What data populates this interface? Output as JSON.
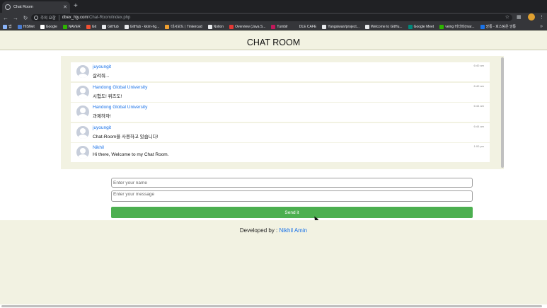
{
  "browser": {
    "tab_title": "Chat Room",
    "not_secure_label": "주의 요함",
    "url_host": "dbex_hjy.com",
    "url_path": "/Chat-Room/index.php",
    "bookmarks": [
      {
        "label": "앱",
        "color": "#8ab4f8"
      },
      {
        "label": "HISNet",
        "color": "#4a7bd0"
      },
      {
        "label": "Google",
        "color": "#ffffff"
      },
      {
        "label": "NAVER",
        "color": "#2db400"
      },
      {
        "label": "Git",
        "color": "#f05033"
      },
      {
        "label": "GitHub",
        "color": "#e8eaed"
      },
      {
        "label": "GitHub - kkim-hg...",
        "color": "#e8eaed"
      },
      {
        "label": "대시보드 | Tinkercad",
        "color": "#f0a030"
      },
      {
        "label": "Notion",
        "color": "#e8eaed"
      },
      {
        "label": "Overview (Java S...",
        "color": "#e53935"
      },
      {
        "label": "Tumblr",
        "color": "#c2185b"
      },
      {
        "label": "DLE CAFE",
        "color": "#35363a"
      },
      {
        "label": "Yangsiwan/project...",
        "color": "#e8eaed"
      },
      {
        "label": "Welcome to GitHu...",
        "color": "#e8eaed"
      },
      {
        "label": "Google Meet",
        "color": "#00897b"
      },
      {
        "label": "veing 머더파(mar...",
        "color": "#2db400"
      },
      {
        "label": "앙통 - 호스팅은 앙통",
        "color": "#1a73e8"
      }
    ]
  },
  "page": {
    "title": "CHAT ROOM",
    "messages": [
      {
        "name": "juyoungit",
        "text": "살려줘...",
        "time": "6:40 am"
      },
      {
        "name": "Handong Global University",
        "text": "시험도! 퀴즈도!",
        "time": "6:40 am"
      },
      {
        "name": "Handong Global University",
        "text": "과제하자!",
        "time": "6:44 am"
      },
      {
        "name": "juyoungit",
        "text": "Chat-Room을 사용하고 있습니다!",
        "time": "6:44 am"
      },
      {
        "name": "Nikhil",
        "text": "Hi there, Welcome to my Chat Room.",
        "time": "1:00 pm"
      }
    ],
    "form": {
      "name_placeholder": "Enter your name",
      "message_placeholder": "Enter your message",
      "send_label": "Send it"
    },
    "footer": {
      "prefix": "Developed by : ",
      "author": "Nikhil Amin"
    }
  }
}
